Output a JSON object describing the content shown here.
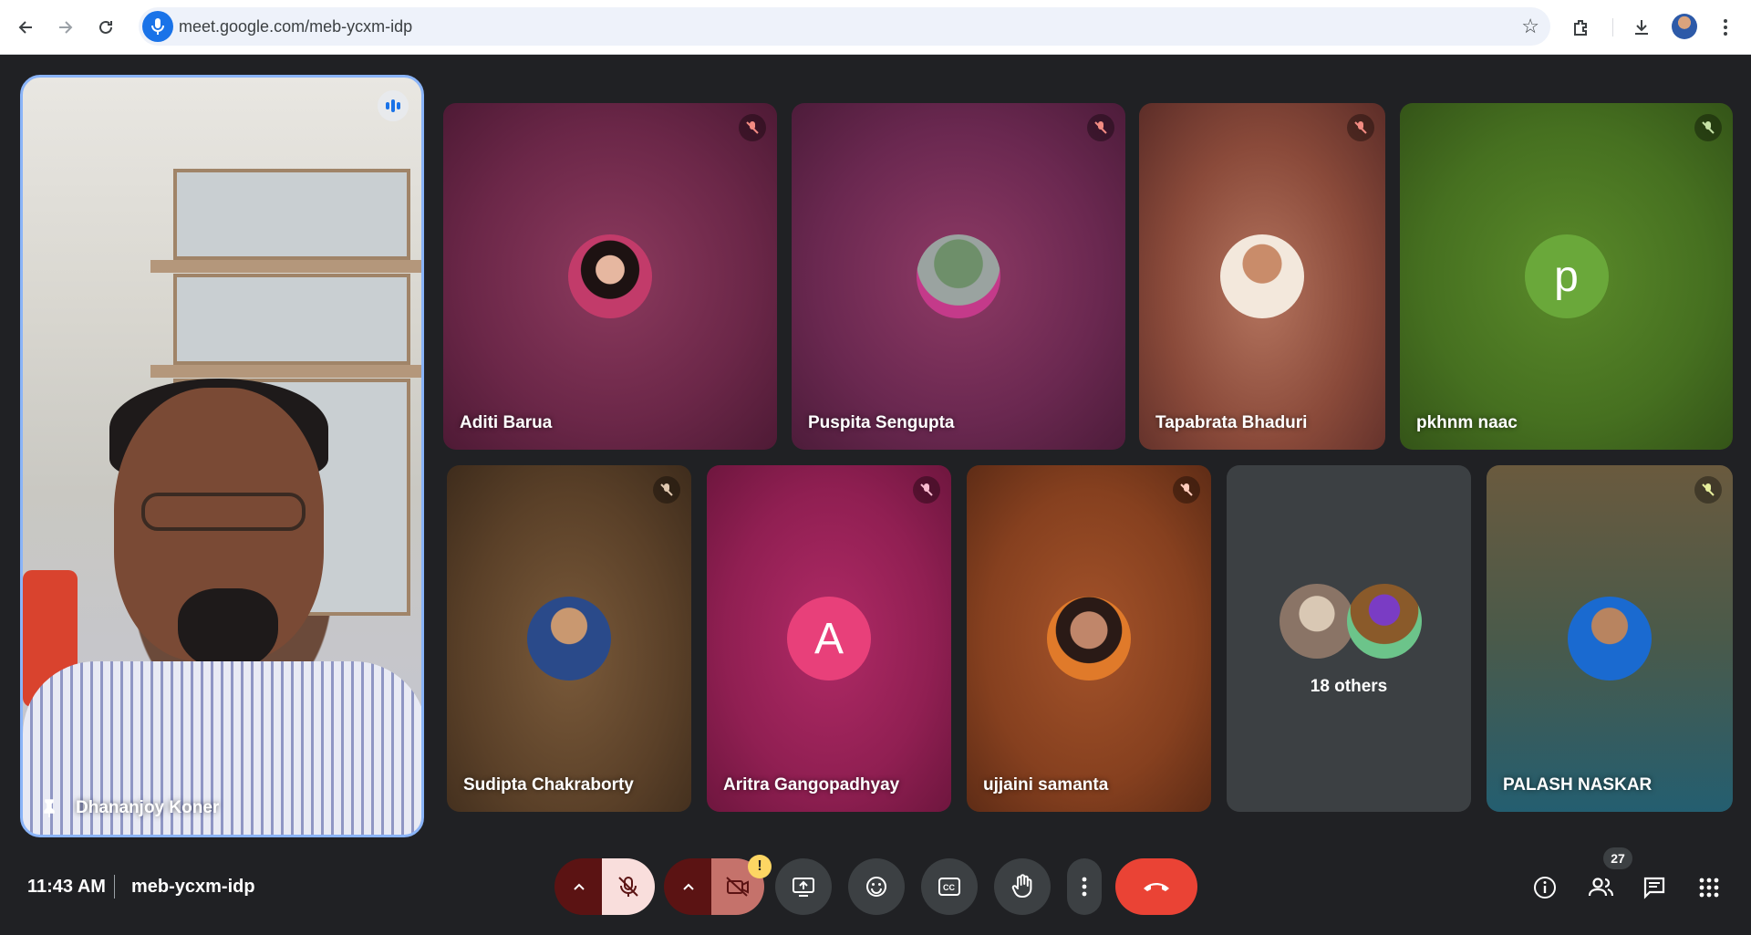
{
  "browser": {
    "url": "meet.google.com/meb-ycxm-idp",
    "icons": [
      "back-icon",
      "forward-icon",
      "reload-icon",
      "mic-icon",
      "star-icon",
      "extensions-icon",
      "download-icon",
      "profile-avatar",
      "more-vert-icon"
    ]
  },
  "pinned": {
    "name": "Dhananjoy Koner",
    "speaking": true
  },
  "tiles_row1": [
    {
      "name": "Aditi Barua",
      "muted": true
    },
    {
      "name": "Puspita Sengupta",
      "muted": true
    },
    {
      "name": "Tapabrata Bhaduri",
      "muted": true
    },
    {
      "name": "pkhnm naac",
      "muted": true,
      "avatar_letter": "p"
    }
  ],
  "tiles_row2": [
    {
      "name": "Sudipta Chakraborty",
      "muted": true
    },
    {
      "name": "Aritra Gangopadhyay",
      "muted": true,
      "avatar_letter": "A"
    },
    {
      "name": "ujjaini samanta",
      "muted": true
    },
    {
      "others_label": "18 others"
    },
    {
      "name": "PALASH NASKAR",
      "muted": true
    }
  ],
  "bottom": {
    "time": "11:43 AM",
    "meeting_code": "meb-ycxm-idp",
    "participant_count": "27",
    "warning": "!"
  },
  "colors": {
    "accent": "#8ab4f8",
    "hangup": "#ea4335",
    "background": "#202124"
  }
}
